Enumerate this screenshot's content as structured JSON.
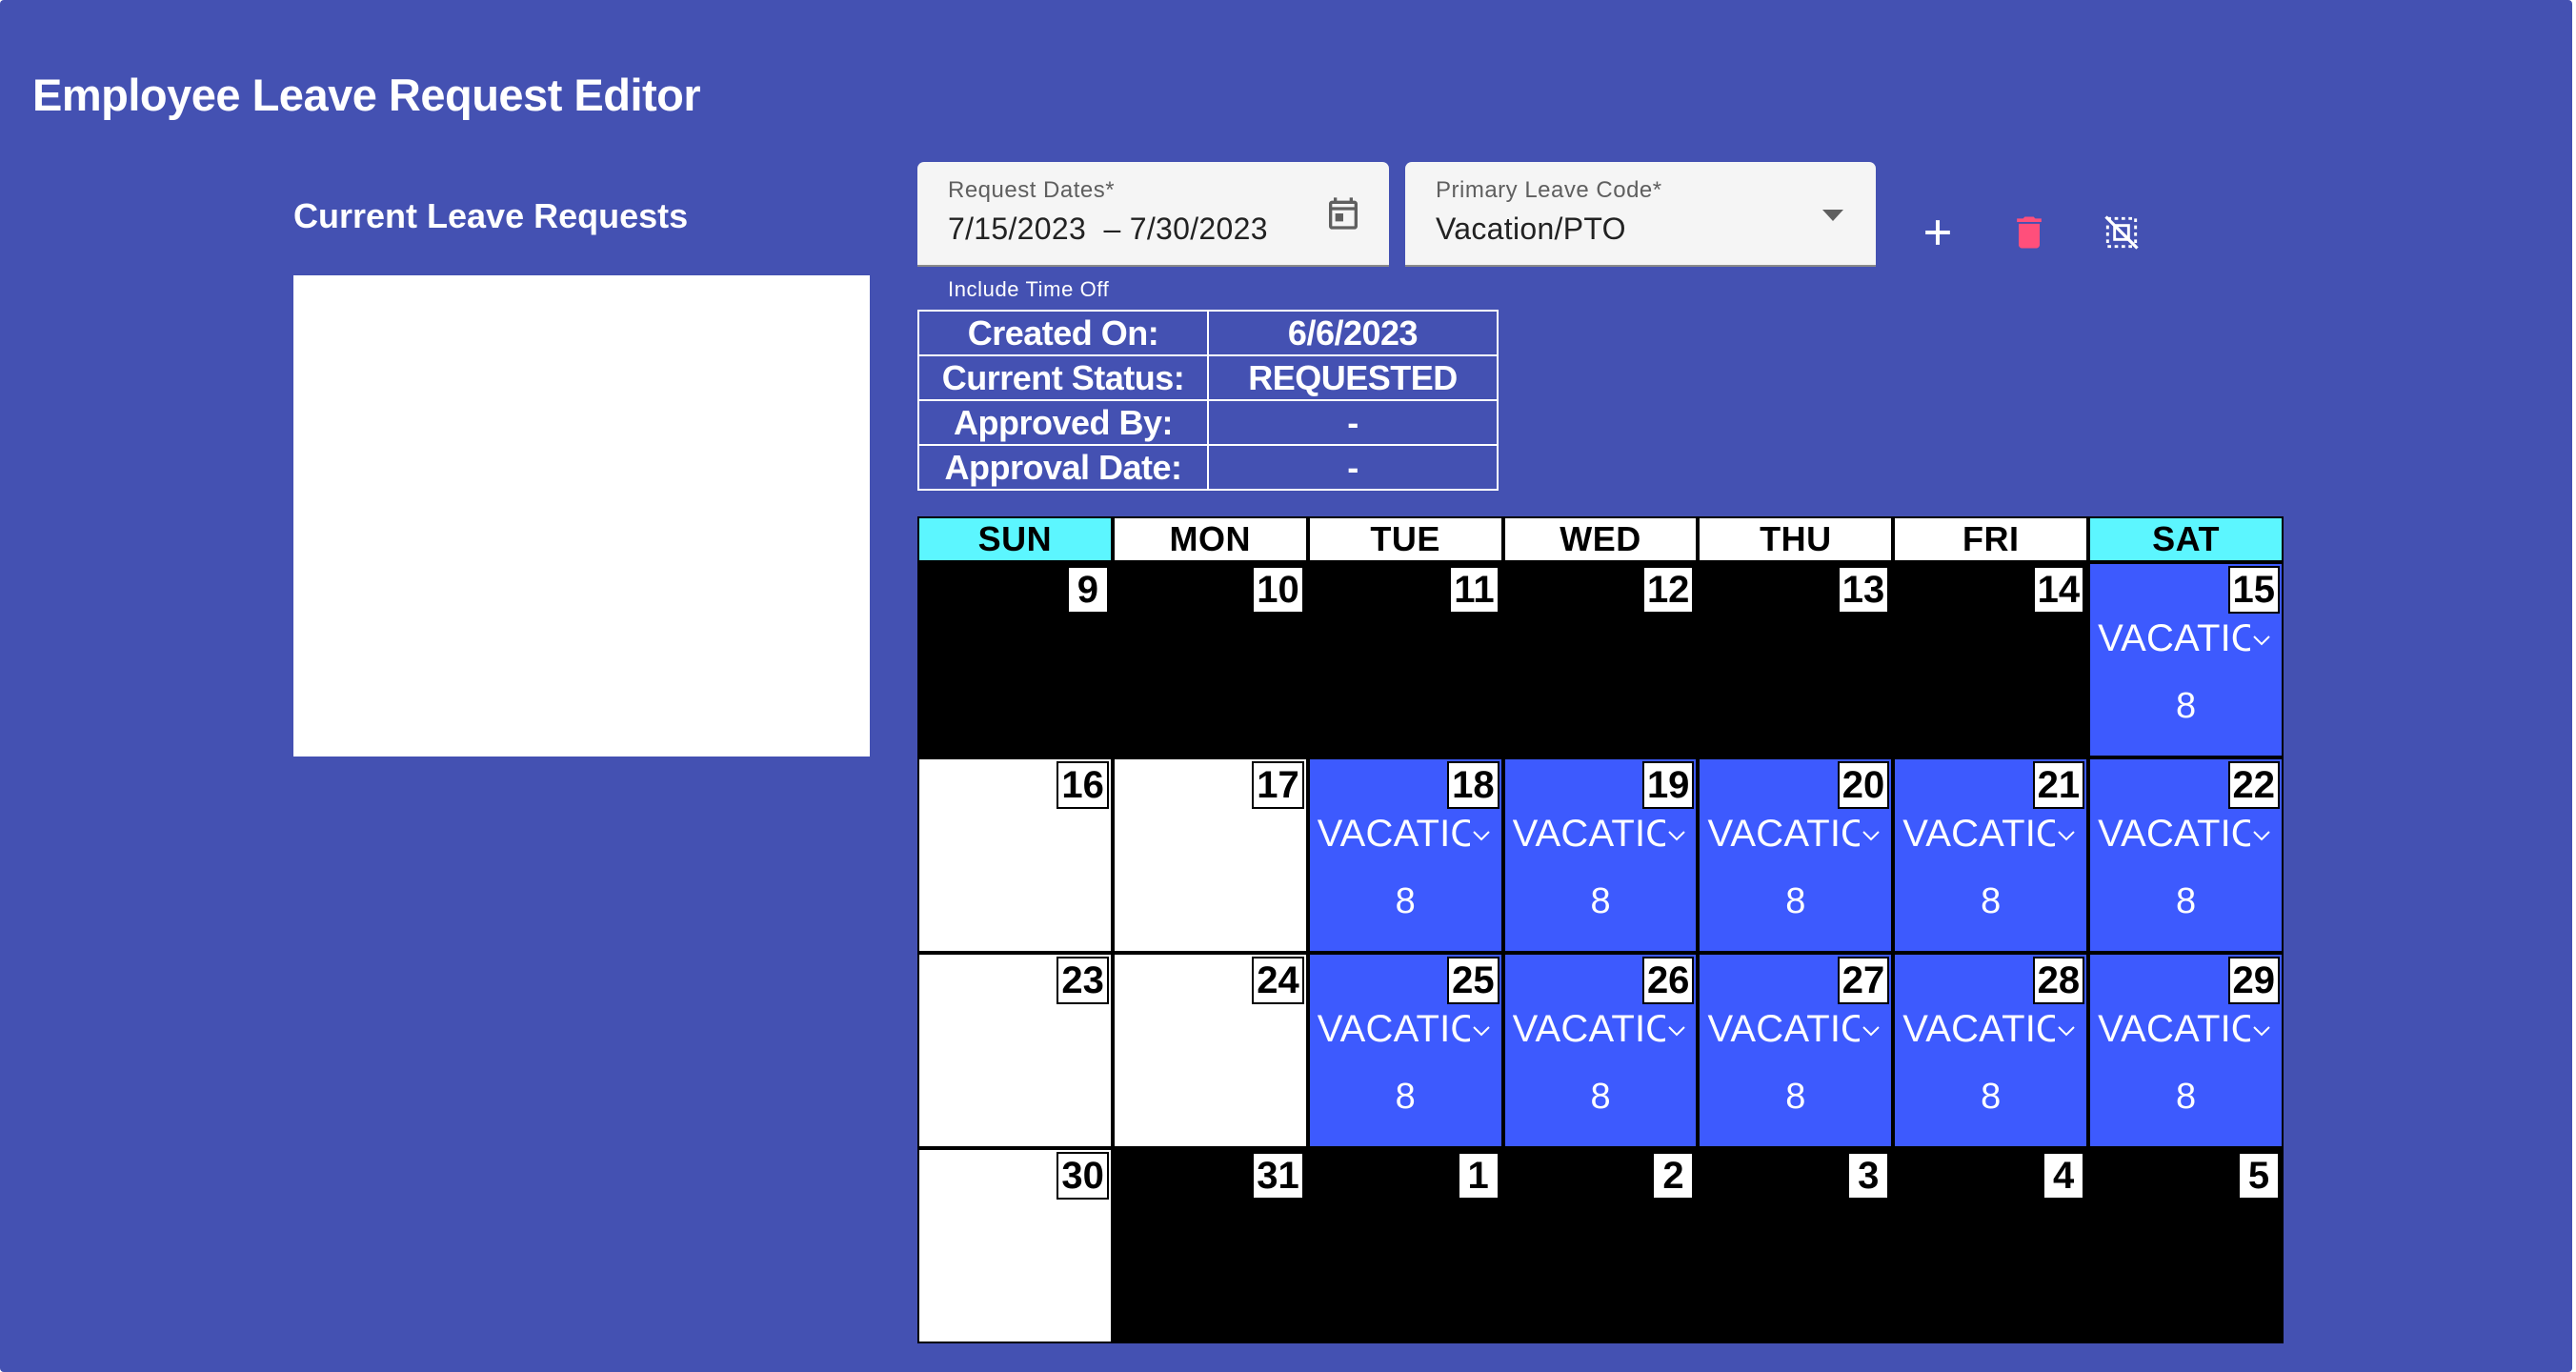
{
  "page": {
    "title": "Employee Leave Request Editor"
  },
  "requests": {
    "title": "Current Leave Requests"
  },
  "form": {
    "dates_label": "Request Dates*",
    "start_date": "7/15/2023",
    "end_date": "7/30/2023",
    "range_separator": "–",
    "leave_code_label": "Primary Leave Code*",
    "leave_code_value": "Vacation/PTO",
    "include_time_off_label": "Include Time Off"
  },
  "toolbar": {
    "add_icon": "plus-icon",
    "delete_icon": "trash-icon",
    "clear_selection_icon": "deselect-icon"
  },
  "info": {
    "rows": [
      {
        "label": "Created On:",
        "value": "6/6/2023"
      },
      {
        "label": "Current Status:",
        "value": "REQUESTED"
      },
      {
        "label": "Approved By:",
        "value": "-"
      },
      {
        "label": "Approval Date:",
        "value": "-"
      }
    ]
  },
  "colors": {
    "background": "#4451b2",
    "leave_day": "#3d5afe",
    "weekend_header": "#5cf6ff",
    "delete_icon": "#ff4f7b"
  },
  "calendar": {
    "days_of_week": [
      "SUN",
      "MON",
      "TUE",
      "WED",
      "THU",
      "FRI",
      "SAT"
    ],
    "weeks": [
      [
        {
          "day": "9",
          "state": "outside"
        },
        {
          "day": "10",
          "state": "outside"
        },
        {
          "day": "11",
          "state": "outside"
        },
        {
          "day": "12",
          "state": "outside"
        },
        {
          "day": "13",
          "state": "outside"
        },
        {
          "day": "14",
          "state": "outside"
        },
        {
          "day": "15",
          "state": "leave",
          "code": "VACATION/PTO",
          "hours": "8"
        }
      ],
      [
        {
          "day": "16",
          "state": "empty"
        },
        {
          "day": "17",
          "state": "empty"
        },
        {
          "day": "18",
          "state": "leave",
          "code": "VACATION/PTO",
          "hours": "8"
        },
        {
          "day": "19",
          "state": "leave",
          "code": "VACATION/PTO",
          "hours": "8"
        },
        {
          "day": "20",
          "state": "leave",
          "code": "VACATION/PTO",
          "hours": "8"
        },
        {
          "day": "21",
          "state": "leave",
          "code": "VACATION/PTO",
          "hours": "8"
        },
        {
          "day": "22",
          "state": "leave",
          "code": "VACATION/PTO",
          "hours": "8"
        }
      ],
      [
        {
          "day": "23",
          "state": "empty"
        },
        {
          "day": "24",
          "state": "empty"
        },
        {
          "day": "25",
          "state": "leave",
          "code": "VACATION/PTO",
          "hours": "8"
        },
        {
          "day": "26",
          "state": "leave",
          "code": "VACATION/PTO",
          "hours": "8"
        },
        {
          "day": "27",
          "state": "leave",
          "code": "VACATION/PTO",
          "hours": "8"
        },
        {
          "day": "28",
          "state": "leave",
          "code": "VACATION/PTO",
          "hours": "8"
        },
        {
          "day": "29",
          "state": "leave",
          "code": "VACATION/PTO",
          "hours": "8"
        }
      ],
      [
        {
          "day": "30",
          "state": "empty"
        },
        {
          "day": "31",
          "state": "outside"
        },
        {
          "day": "1",
          "state": "outside"
        },
        {
          "day": "2",
          "state": "outside"
        },
        {
          "day": "3",
          "state": "outside"
        },
        {
          "day": "4",
          "state": "outside"
        },
        {
          "day": "5",
          "state": "outside"
        }
      ]
    ]
  }
}
